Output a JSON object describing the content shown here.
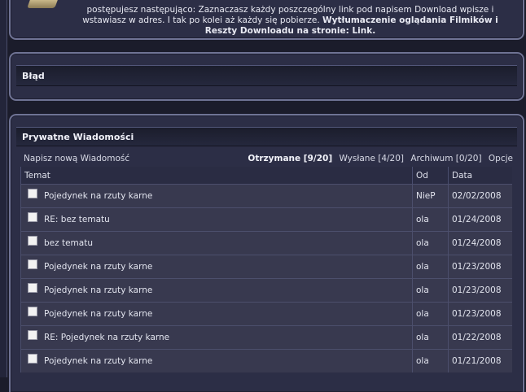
{
  "info_panel": {
    "line1": "postępujesz następująco: Zaznaczasz każdy poszczególny link pod napisem Download wpisze i",
    "line2_plain": "wstawiasz w adres. I tak po kolei aż każdy się pobierze. ",
    "line2_bold": "Wytłumaczenie oglądania Filmików i",
    "line3_bold": "Reszty Downloadu na stronie: Link."
  },
  "error_panel": {
    "title": "Błąd"
  },
  "pm_panel": {
    "title": "Prywatne Wiadomości",
    "compose_label": "Napisz nową Wiadomość",
    "folders": {
      "inbox": "Otrzymane [9/20]",
      "sent": "Wysłane [4/20]",
      "archive": "Archiwum [0/20]",
      "options": "Opcje"
    },
    "columns": {
      "subject": "Temat",
      "from": "Od",
      "date": "Data"
    },
    "messages": [
      {
        "subject": "Pojedynek na rzuty karne",
        "from": "NieP",
        "date": "02/02/2008"
      },
      {
        "subject": "RE: bez tematu",
        "from": "ola",
        "date": "01/24/2008"
      },
      {
        "subject": "bez tematu",
        "from": "ola",
        "date": "01/24/2008"
      },
      {
        "subject": "Pojedynek na rzuty karne",
        "from": "ola",
        "date": "01/23/2008"
      },
      {
        "subject": "Pojedynek na rzuty karne",
        "from": "ola",
        "date": "01/23/2008"
      },
      {
        "subject": "Pojedynek na rzuty karne",
        "from": "ola",
        "date": "01/23/2008"
      },
      {
        "subject": "RE: Pojedynek na rzuty karne",
        "from": "ola",
        "date": "01/22/2008"
      },
      {
        "subject": "Pojedynek na rzuty karne",
        "from": "ola",
        "date": "01/21/2008"
      }
    ]
  }
}
